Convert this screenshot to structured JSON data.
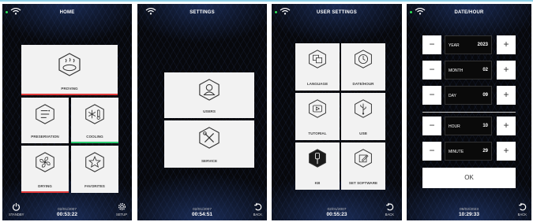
{
  "colors": {
    "proving_bar": "#e23b3b",
    "cooling_bar": "#2ecc71",
    "drying_bar": "#e23b3b",
    "accent": "#8fd0e6"
  },
  "home": {
    "title": "HOME",
    "tiles": {
      "proving": {
        "label": "PROVING",
        "icon": "bread-heat-icon"
      },
      "preservation": {
        "label": "PRESERVATION",
        "icon": "preservation-lines-icon"
      },
      "cooling": {
        "label": "COOLING",
        "icon": "snowflake-thermometer-icon"
      },
      "drying": {
        "label": "DRYING",
        "icon": "fan-icon"
      },
      "favorites": {
        "label": "FAVORITES",
        "icon": "star-icon"
      }
    },
    "standby_label": "STANDBY",
    "setup_label": "SETUP",
    "date": "02/01/2007",
    "time": "00:53:22"
  },
  "settings": {
    "title": "SETTINGS",
    "tiles": {
      "users": {
        "label": "USERS",
        "icon": "user-icon"
      },
      "service": {
        "label": "SERVICE",
        "icon": "tools-icon"
      }
    },
    "back_label": "BACK",
    "date": "02/01/2007",
    "time": "00:54:51"
  },
  "user_settings": {
    "title": "USER SETTINGS",
    "tiles": {
      "language": {
        "label": "LANGUAGE",
        "icon": "translate-icon"
      },
      "datehour": {
        "label": "DATE/HOUR",
        "icon": "clock-icon"
      },
      "tutorial": {
        "label": "TUTORIAL",
        "icon": "play-icon"
      },
      "usb": {
        "label": "USB",
        "icon": "usb-icon"
      },
      "kb": {
        "label": "KB",
        "icon": "probe-icon"
      },
      "set_software": {
        "label": "SET SOFTWARE",
        "icon": "edit-icon"
      }
    },
    "back_label": "BACK",
    "date": "02/01/2007",
    "time": "00:55:23"
  },
  "date_hour": {
    "title": "DATE/HOUR",
    "fields": [
      {
        "label": "YEAR",
        "value": "2023"
      },
      {
        "label": "MONTH",
        "value": "02"
      },
      {
        "label": "DAY",
        "value": "09"
      },
      {
        "label": "HOUR",
        "value": "10"
      },
      {
        "label": "MINUTE",
        "value": "29"
      }
    ],
    "minus": "−",
    "plus": "+",
    "ok_label": "OK",
    "back_label": "BACK",
    "date": "09/02/2023",
    "time": "10:29:33"
  }
}
